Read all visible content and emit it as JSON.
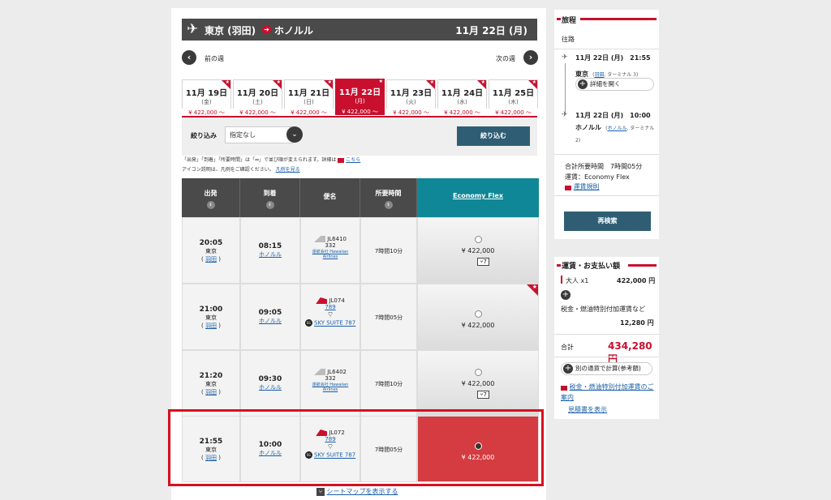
{
  "route": {
    "from": "東京 (羽田)",
    "to": "ホノルル",
    "date": "11月 22日 (月)"
  },
  "nav": {
    "prev": "前の週",
    "next": "次の週"
  },
  "date_tabs": [
    {
      "day": "11月 19日",
      "dow": "(金)",
      "price": "¥ 422,000 〜",
      "selected": false
    },
    {
      "day": "11月 20日",
      "dow": "(土)",
      "price": "¥ 422,000 〜",
      "selected": false
    },
    {
      "day": "11月 21日",
      "dow": "(日)",
      "price": "¥ 422,000 〜",
      "selected": false
    },
    {
      "day": "11月 22日",
      "dow": "(月)",
      "price": "¥ 422,000 〜",
      "selected": true
    },
    {
      "day": "11月 23日",
      "dow": "(火)",
      "price": "¥ 422,000 〜",
      "selected": false
    },
    {
      "day": "11月 24日",
      "dow": "(水)",
      "price": "¥ 422,000 〜",
      "selected": false
    },
    {
      "day": "11月 25日",
      "dow": "(木)",
      "price": "¥ 422,000 〜",
      "selected": false
    }
  ],
  "filter": {
    "label": "絞り込み",
    "selected": "指定なし",
    "button": "絞り込む"
  },
  "notes": {
    "line1": "「出発」「到着」「所要時間」は「⇔」で並び順が変えられます。詳細は",
    "line1_link": "こちら",
    "line2": "アイコン説明は、凡例をご確認ください。",
    "line2_link": "凡例を見る"
  },
  "table": {
    "headers": {
      "depart": "出発",
      "arrive": "到着",
      "flight": "便名",
      "duration": "所要時間",
      "fare": "Economy Flex"
    },
    "rows": [
      {
        "dep_time": "20:05",
        "dep_city": "東京",
        "dep_airport": "羽田",
        "arr_time": "08:15",
        "arr_city": "ホノルル",
        "flight_no": "JL6410",
        "aircraft": "332",
        "operator": "運航会社 Hawaiian Airlines",
        "suite": "",
        "duration": "7時間10分",
        "price": "¥ 422,000",
        "seat": "7"
      },
      {
        "dep_time": "21:00",
        "dep_city": "東京",
        "dep_airport": "羽田",
        "arr_time": "09:05",
        "arr_city": "ホノルル",
        "flight_no": "JL074",
        "aircraft": "789",
        "operator": "",
        "suite": "SKY SUITE 787",
        "duration": "7時間05分",
        "price": "¥ 422,000",
        "seat": ""
      },
      {
        "dep_time": "21:20",
        "dep_city": "東京",
        "dep_airport": "羽田",
        "arr_time": "09:30",
        "arr_city": "ホノルル",
        "flight_no": "JL6402",
        "aircraft": "332",
        "operator": "運航会社 Hawaiian Airlines",
        "suite": "",
        "duration": "7時間10分",
        "price": "¥ 422,000",
        "seat": "7"
      },
      {
        "dep_time": "21:55",
        "dep_city": "東京",
        "dep_airport": "羽田",
        "arr_time": "10:00",
        "arr_city": "ホノルル",
        "flight_no": "JL072",
        "aircraft": "789",
        "operator": "",
        "suite": "SKY SUITE 787",
        "duration": "7時間05分",
        "price": "¥ 422,000",
        "seat": ""
      }
    ]
  },
  "seatmap_link": "シートマップを表示する",
  "itinerary": {
    "title": "旅程",
    "leg": "往路",
    "dep_datetime": "11月 22日 (月)　21:55",
    "dep_city": "東京",
    "dep_airport": "羽田",
    "dep_terminal": ", ターミナル 3)",
    "details_btn": "詳細を開く",
    "arr_datetime": "11月 22日 (月)　10:00",
    "arr_city": "ホノルル",
    "arr_airport": "ホノルル",
    "arr_terminal": ", ターミナル 2)",
    "total_time": "合計所要時間　7時間05分",
    "fare_type": "運賃：Economy Flex",
    "fare_rules": "運賃規則",
    "research_btn": "再検索"
  },
  "payment": {
    "title": "運賃・お支払い額",
    "adult_label": "大人 x1",
    "adult_price": "422,000 円",
    "tax_label": "税金・燃油特別付加運賃など",
    "tax_price": "12,280 円",
    "total_label": "合計",
    "total_price": "434,280 円",
    "currency_btn": "別の通貨で計算(参考額)",
    "tax_info_link": "税金・燃油特別付加運賃のご案内",
    "estimate_link": "見積書を表示"
  },
  "colors": {
    "brand_red": "#c8102e",
    "teal": "#0f8796",
    "dark_btn": "#2f5e74"
  }
}
